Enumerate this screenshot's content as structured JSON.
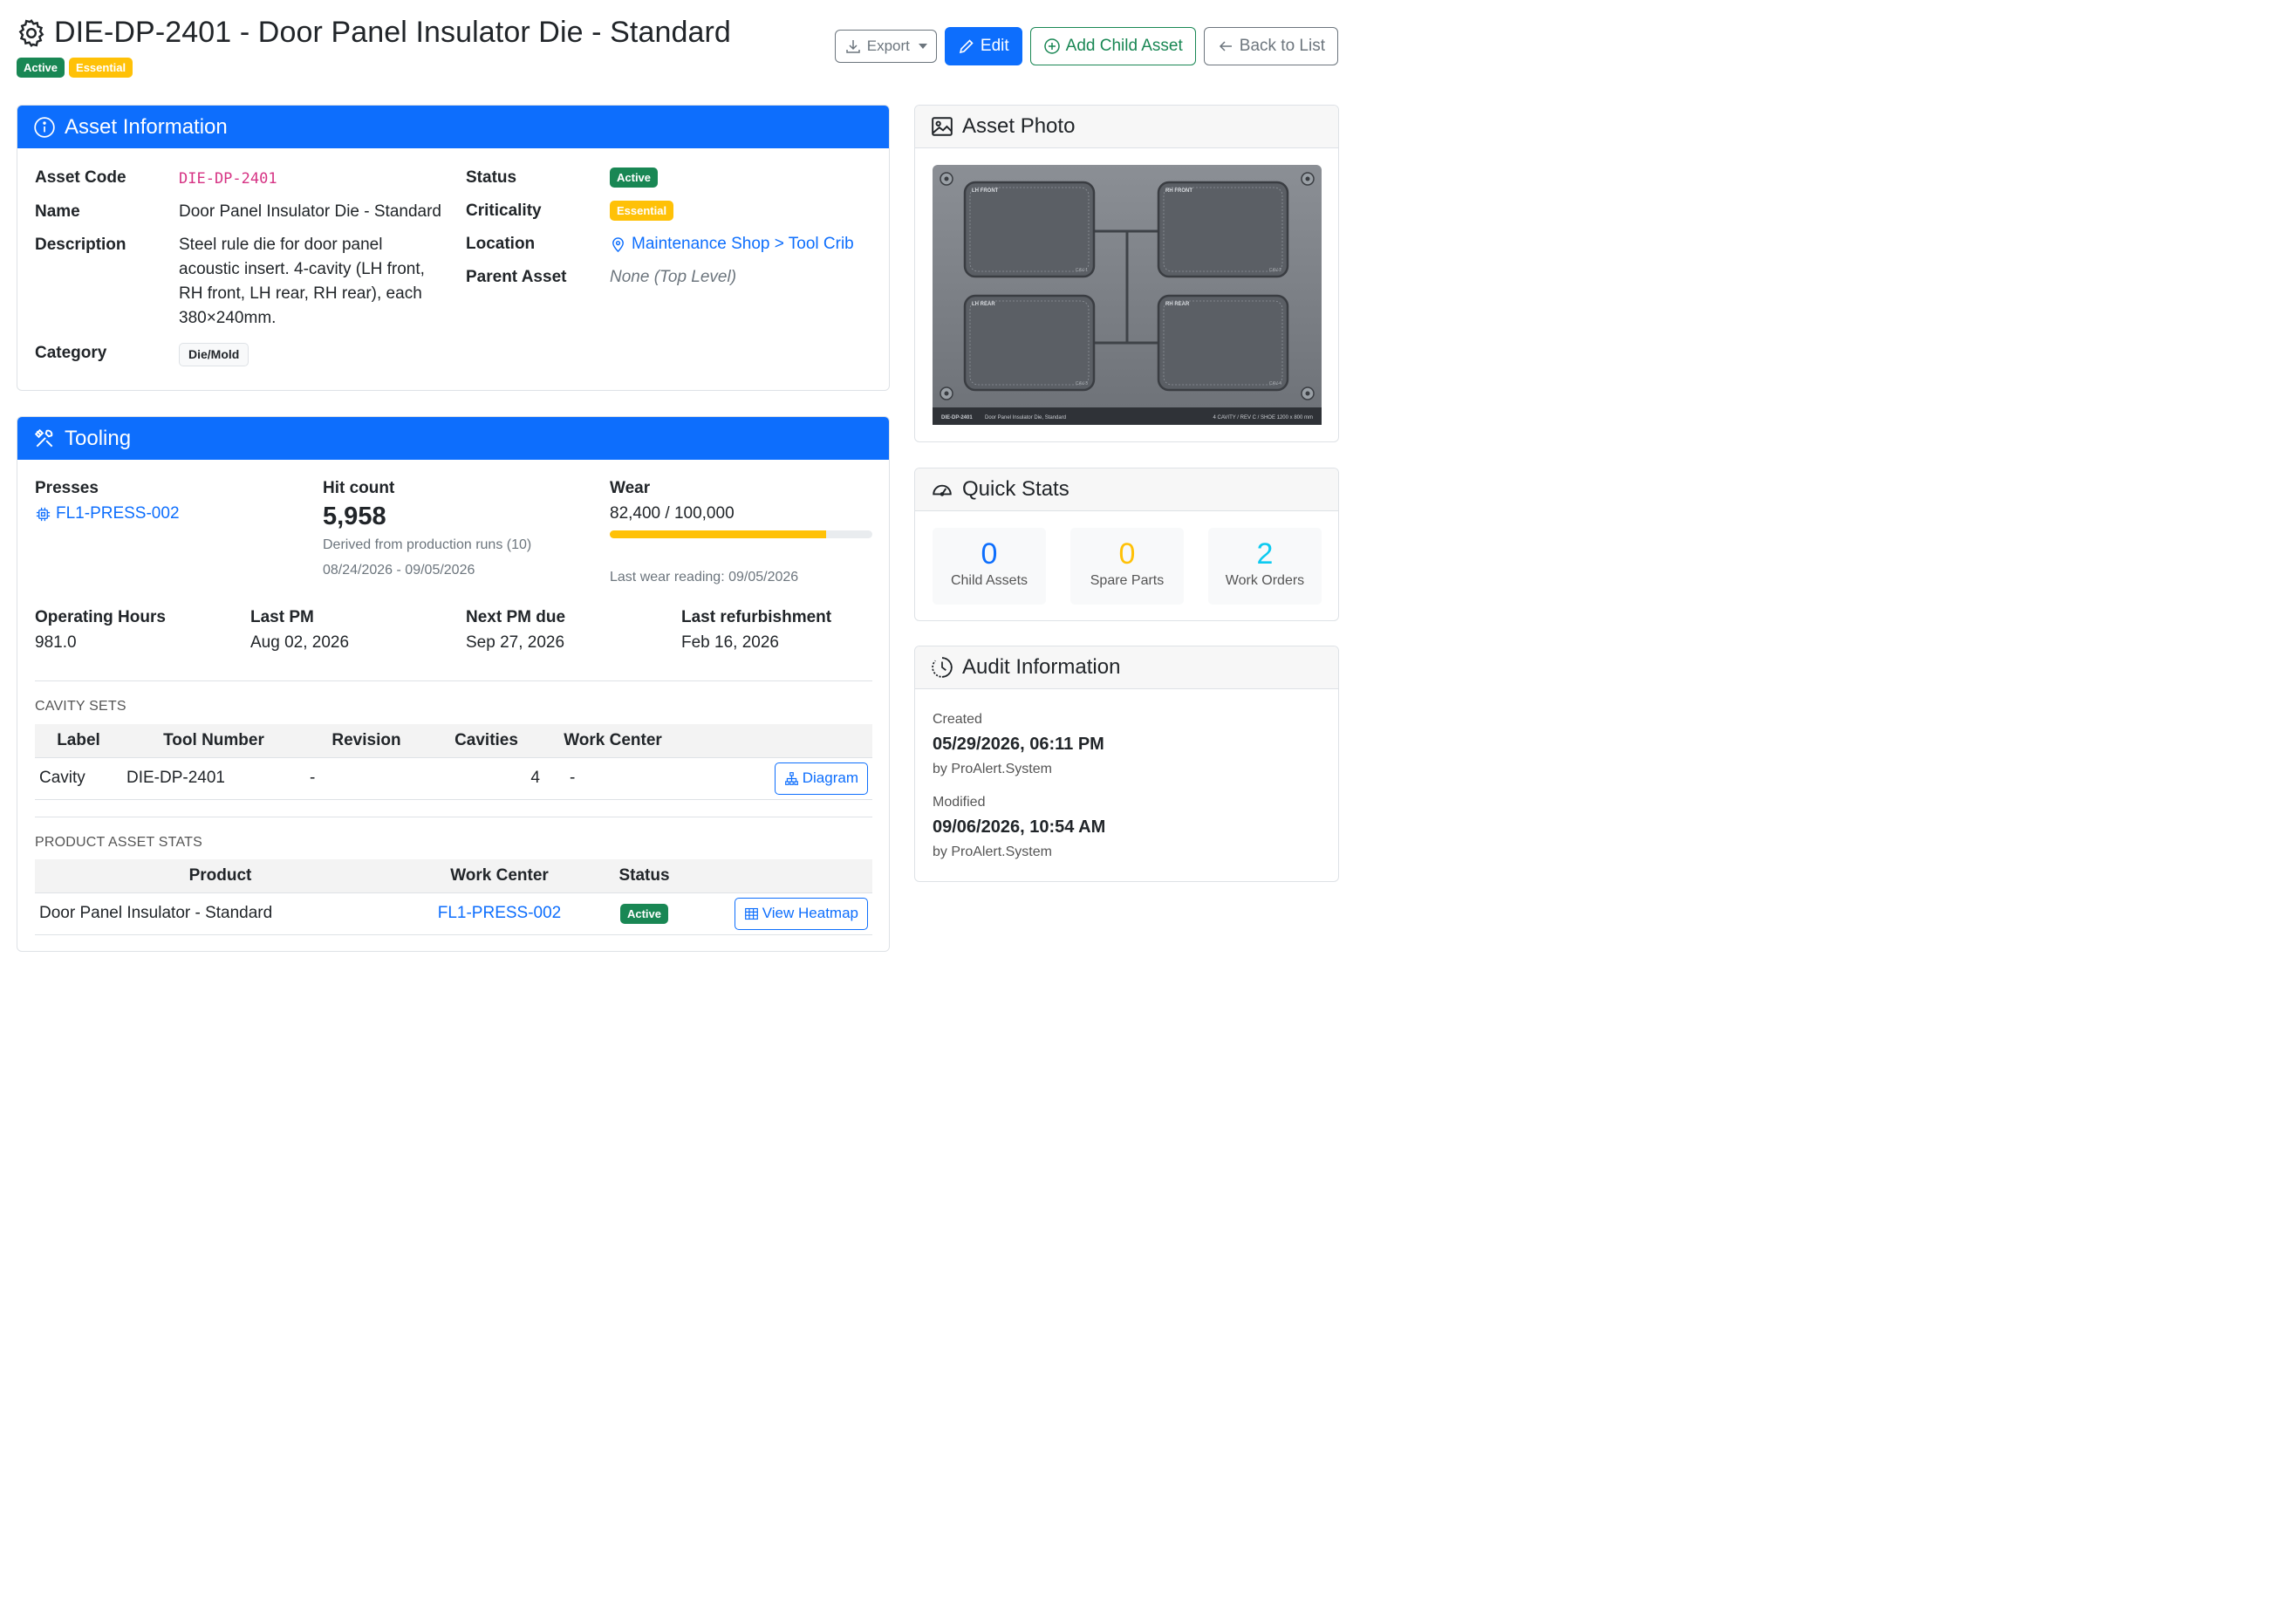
{
  "header": {
    "title": "DIE-DP-2401 - Door Panel Insulator Die - Standard",
    "badges": [
      "Active",
      "Essential"
    ],
    "actions": {
      "export": "Export",
      "edit": "Edit",
      "add_child": "Add Child Asset",
      "back": "Back to List"
    }
  },
  "asset_info": {
    "header": "Asset Information",
    "labels": {
      "code": "Asset Code",
      "name": "Name",
      "description": "Description",
      "category": "Category",
      "status": "Status",
      "criticality": "Criticality",
      "location": "Location",
      "parent": "Parent Asset"
    },
    "code": "DIE-DP-2401",
    "name": "Door Panel Insulator Die - Standard",
    "description": "Steel rule die for door panel acoustic insert. 4-cavity (LH front, RH front, LH rear, RH rear), each 380×240mm.",
    "category": "Die/Mold",
    "status": "Active",
    "criticality": "Essential",
    "location": "Maintenance Shop > Tool Crib",
    "parent": "None (Top Level)"
  },
  "tooling": {
    "header": "Tooling",
    "presses_label": "Presses",
    "press": "FL1-PRESS-002",
    "hit_count_label": "Hit count",
    "hit_count": "5,958",
    "hit_derived": "Derived from production runs (10)",
    "hit_range": "08/24/2026 - 09/05/2026",
    "wear_label": "Wear",
    "wear_value": "82,400 / 100,000",
    "wear_fraction": 0.824,
    "wear_reading": "Last wear reading: 09/05/2026",
    "op_hours_label": "Operating Hours",
    "op_hours": "981.0",
    "last_pm_label": "Last PM",
    "last_pm": "Aug 02, 2026",
    "next_pm_label": "Next PM due",
    "next_pm": "Sep 27, 2026",
    "last_refurb_label": "Last refurbishment",
    "last_refurb": "Feb 16, 2026",
    "cavity_sets_caption": "CAVITY SETS",
    "cavity_columns": [
      "Label",
      "Tool Number",
      "Revision",
      "Cavities",
      "Work Center"
    ],
    "cavity_row": {
      "label": "Cavity",
      "tool_number": "DIE-DP-2401",
      "revision": "-",
      "cavities": "4",
      "work_center": "-",
      "action": "Diagram"
    },
    "product_stats_caption": "PRODUCT ASSET STATS",
    "product_columns": [
      "Product",
      "Work Center",
      "Status"
    ],
    "product_row": {
      "product": "Door Panel Insulator - Standard",
      "work_center": "FL1-PRESS-002",
      "status": "Active",
      "action": "View Heatmap"
    }
  },
  "photo": {
    "header": "Asset Photo",
    "cavities": [
      "LH FRONT",
      "RH FRONT",
      "LH REAR",
      "RH REAR"
    ],
    "cav_codes": [
      "CAV-1",
      "CAV-2",
      "CAV-3",
      "CAV-4"
    ],
    "footer_code": "DIE-DP-2401",
    "footer_name": "Door Panel Insulator Die, Standard",
    "footer_specs": "4 CAVITY  /  REV C  /  SHOE 1200 x 800 mm"
  },
  "quick_stats": {
    "header": "Quick Stats",
    "items": [
      {
        "value": "0",
        "label": "Child Assets",
        "color": "#0d6efd"
      },
      {
        "value": "0",
        "label": "Spare Parts",
        "color": "#ffc107"
      },
      {
        "value": "2",
        "label": "Work Orders",
        "color": "#0dcaf0"
      }
    ]
  },
  "audit": {
    "header": "Audit Information",
    "created_label": "Created",
    "created": "05/29/2026, 06:11 PM",
    "created_by": "by ProAlert.System",
    "modified_label": "Modified",
    "modified": "09/06/2026, 10:54 AM",
    "modified_by": "by ProAlert.System"
  },
  "colors": {
    "primary": "#0d6efd",
    "success": "#198754",
    "warning": "#ffc107",
    "info": "#0dcaf0"
  }
}
